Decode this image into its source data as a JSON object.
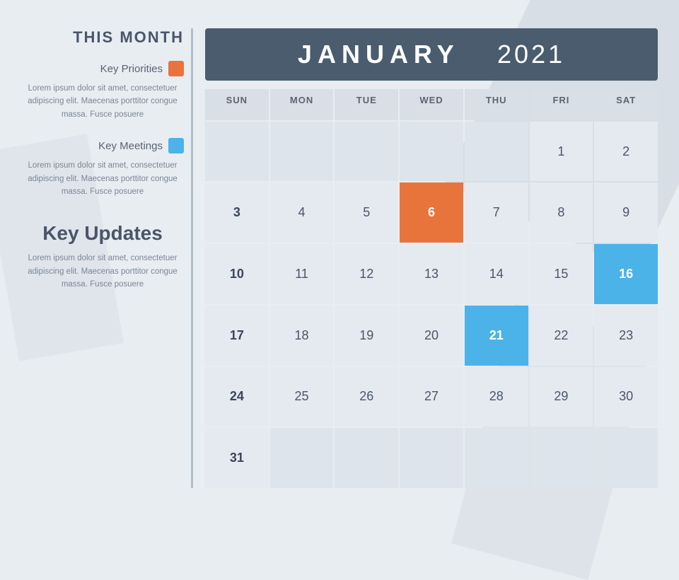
{
  "sidebar": {
    "title": "THIS MONTH",
    "priorities": {
      "label": "Key Priorities",
      "color": "orange",
      "body": "Lorem ipsum dolor sit amet, consectetuer adipiscing elit. Maecenas porttitor congue massa. Fusce posuere"
    },
    "meetings": {
      "label": "Key Meetings",
      "color": "blue",
      "body": "Lorem ipsum dolor sit amet, consectetuer adipiscing elit. Maecenas porttitor congue massa. Fusce posuere"
    },
    "updates": {
      "title": "Key Updates",
      "body": "Lorem ipsum dolor sit amet, consectetuer adipiscing elit. Maecenas porttitor congue massa. Fusce posuere"
    }
  },
  "calendar": {
    "month": "JANUARY",
    "year": "2021",
    "day_headers": [
      "SUN",
      "MON",
      "TUE",
      "WED",
      "THU",
      "FRI",
      "SAT"
    ],
    "weeks": [
      [
        {
          "num": "",
          "type": "empty"
        },
        {
          "num": "",
          "type": "empty"
        },
        {
          "num": "",
          "type": "empty"
        },
        {
          "num": "",
          "type": "empty"
        },
        {
          "num": "",
          "type": "empty"
        },
        {
          "num": "1",
          "type": "normal"
        },
        {
          "num": "2",
          "type": "normal"
        }
      ],
      [
        {
          "num": "3",
          "type": "row-start"
        },
        {
          "num": "4",
          "type": "normal"
        },
        {
          "num": "5",
          "type": "normal"
        },
        {
          "num": "6",
          "type": "highlight-orange"
        },
        {
          "num": "7",
          "type": "normal"
        },
        {
          "num": "8",
          "type": "normal"
        },
        {
          "num": "9",
          "type": "normal"
        }
      ],
      [
        {
          "num": "10",
          "type": "row-start"
        },
        {
          "num": "11",
          "type": "normal"
        },
        {
          "num": "12",
          "type": "normal"
        },
        {
          "num": "13",
          "type": "normal"
        },
        {
          "num": "14",
          "type": "normal"
        },
        {
          "num": "15",
          "type": "normal"
        },
        {
          "num": "16",
          "type": "highlight-blue"
        }
      ],
      [
        {
          "num": "17",
          "type": "row-start"
        },
        {
          "num": "18",
          "type": "normal"
        },
        {
          "num": "19",
          "type": "normal"
        },
        {
          "num": "20",
          "type": "normal"
        },
        {
          "num": "21",
          "type": "highlight-blue"
        },
        {
          "num": "22",
          "type": "normal"
        },
        {
          "num": "23",
          "type": "normal"
        }
      ],
      [
        {
          "num": "24",
          "type": "row-start"
        },
        {
          "num": "25",
          "type": "normal"
        },
        {
          "num": "26",
          "type": "normal"
        },
        {
          "num": "27",
          "type": "normal"
        },
        {
          "num": "28",
          "type": "normal"
        },
        {
          "num": "29",
          "type": "normal"
        },
        {
          "num": "30",
          "type": "normal"
        }
      ],
      [
        {
          "num": "31",
          "type": "row-start"
        },
        {
          "num": "",
          "type": "empty"
        },
        {
          "num": "",
          "type": "empty"
        },
        {
          "num": "",
          "type": "empty"
        },
        {
          "num": "",
          "type": "empty"
        },
        {
          "num": "",
          "type": "empty"
        },
        {
          "num": "",
          "type": "empty"
        }
      ]
    ]
  }
}
